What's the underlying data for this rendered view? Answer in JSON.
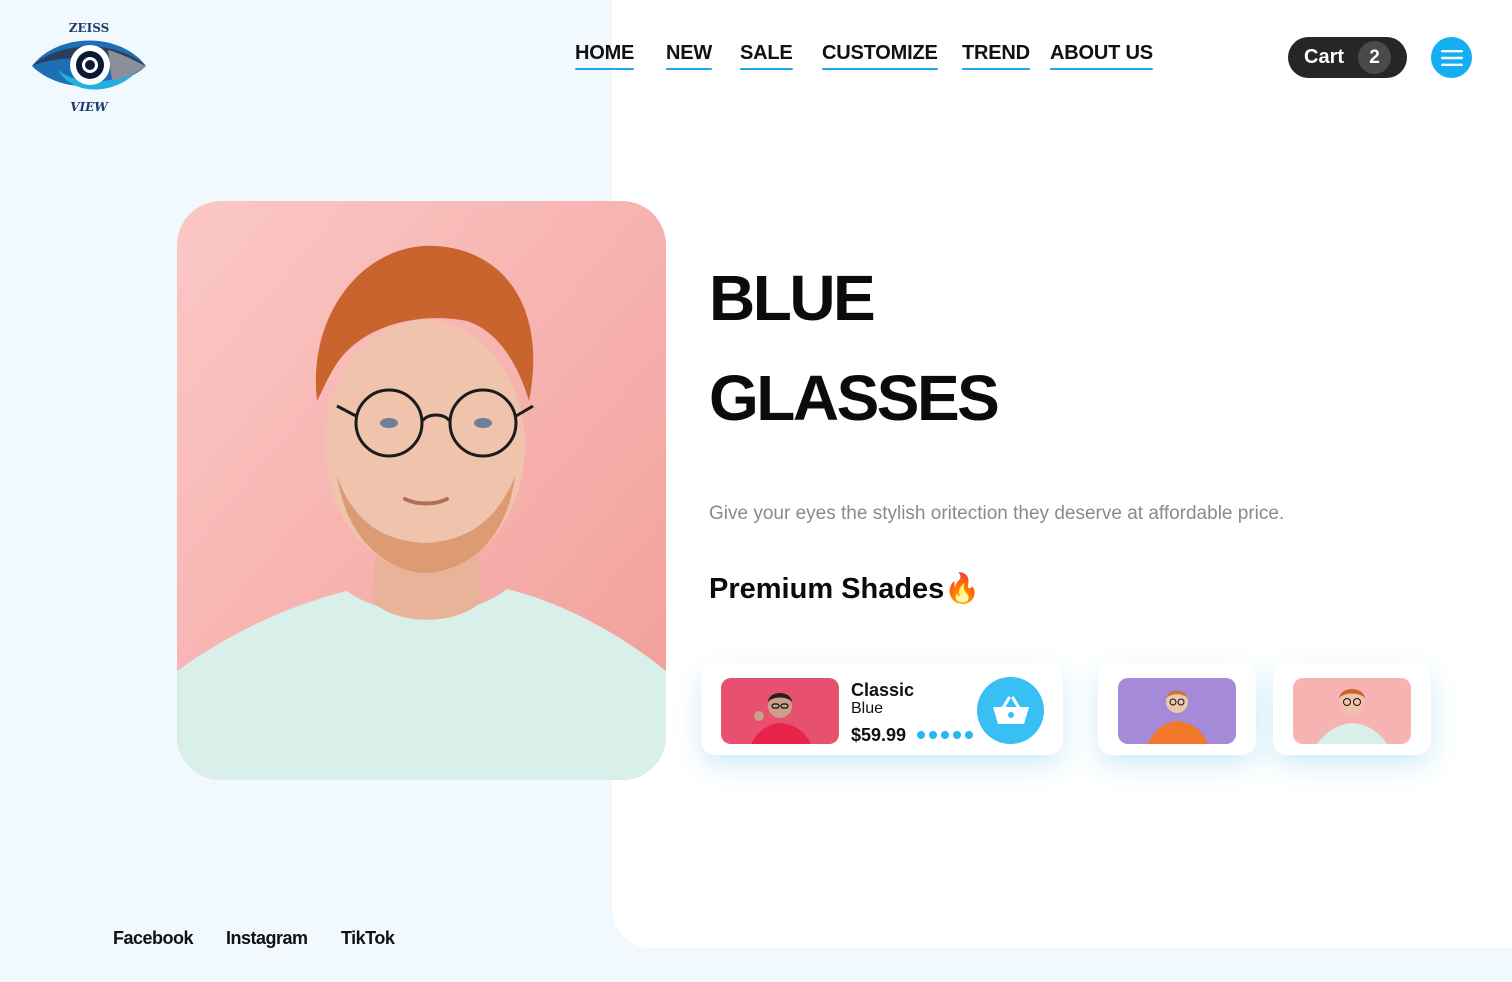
{
  "brand": {
    "logo_top_text": "ZEISS",
    "logo_bottom_text": "VIEW",
    "accent_color": "#1ea7ea"
  },
  "nav": {
    "items": [
      {
        "label": "HOME"
      },
      {
        "label": "NEW"
      },
      {
        "label": "SALE"
      },
      {
        "label": "CUSTOMIZE"
      },
      {
        "label": "TREND"
      },
      {
        "label": "ABOUT US"
      }
    ]
  },
  "cart": {
    "label": "Cart",
    "count": "2"
  },
  "menu": {
    "icon": "hamburger-menu-icon"
  },
  "hero": {
    "title_line1": "BLUE",
    "title_line2": "GLASSES",
    "subtitle": "Give your eyes the stylish oritection they deserve at affordable price.",
    "section_heading": "Premium Shades🔥",
    "photo_background": "#f7b8b6"
  },
  "products": {
    "featured": {
      "name": "Classic",
      "color": "Blue",
      "price": "$59.99",
      "carousel_dots": 5,
      "basket_icon": "shopping-basket-icon"
    }
  },
  "footer": {
    "social": [
      {
        "label": "Facebook"
      },
      {
        "label": "Instagram"
      },
      {
        "label": "TikTok"
      }
    ]
  }
}
